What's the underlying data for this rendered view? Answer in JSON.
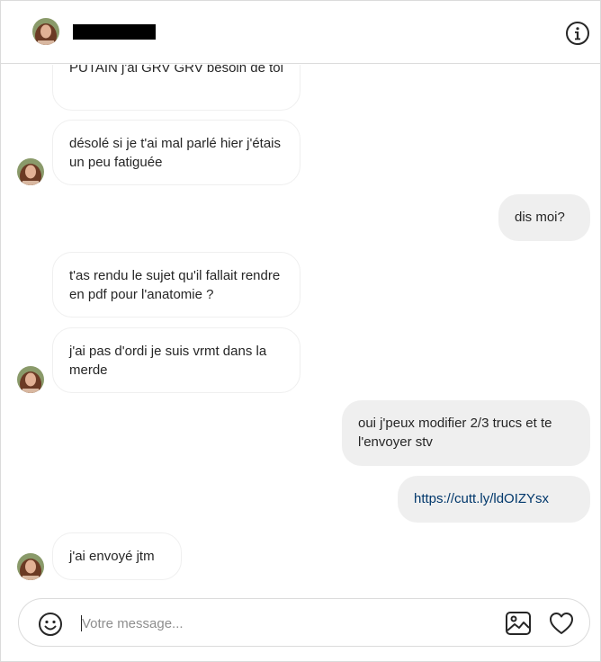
{
  "header": {
    "contact_name": "",
    "info_icon": "info-icon"
  },
  "messages": [
    {
      "side": "in",
      "text": "PUTAIN j'ai GRV GRV besoin de toi"
    },
    {
      "side": "in",
      "text": "désolé si je t'ai mal parlé hier j'étais un peu fatiguée"
    },
    {
      "side": "out",
      "text": "dis moi?"
    },
    {
      "side": "in",
      "text": "t'as rendu le sujet qu'il fallait rendre en pdf pour l'anatomie ?"
    },
    {
      "side": "in",
      "text": "j'ai pas d'ordi je suis vrmt dans la merde"
    },
    {
      "side": "out",
      "text": "oui j'peux modifier 2/3 trucs et te l'envoyer stv"
    },
    {
      "side": "out",
      "text": "https://cutt.ly/ldOIZYsx",
      "is_link": true
    },
    {
      "side": "in",
      "text": "j'ai envoyé jtm"
    }
  ],
  "composer": {
    "placeholder": "Votre message...",
    "emoji_icon": "smiley-icon",
    "image_icon": "image-icon",
    "like_icon": "heart-icon"
  },
  "colors": {
    "incoming_bg": "#ffffff",
    "outgoing_bg": "#efefef",
    "border": "#dbdbdb",
    "link": "#00376b"
  }
}
